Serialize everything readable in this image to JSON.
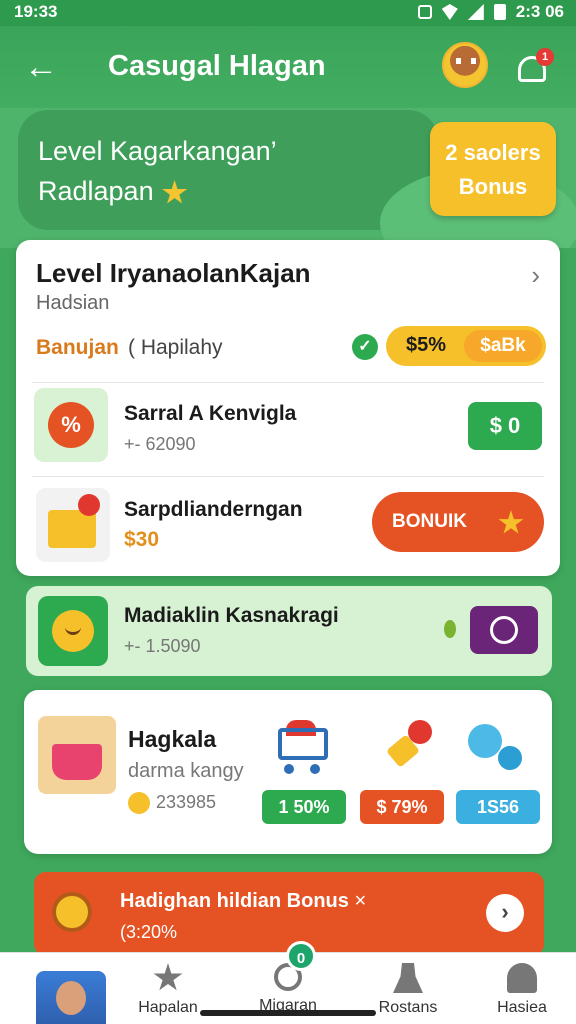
{
  "status_bar": {
    "time": "19:33",
    "right_time": "2:3 06"
  },
  "header": {
    "title": "Casugal Hlagan"
  },
  "notifications": {
    "badge": "1"
  },
  "banner": {
    "line1": "Level Kagarkangan’",
    "line2": "Radlapan",
    "badge_top": "2 saolers",
    "badge_bottom": "Bonus"
  },
  "level_card": {
    "title": "Level IryanaolanKajan",
    "subtitle": "Hadsian",
    "status_label": "Banujan",
    "status_note": "( Hapilahy",
    "pill_a": "$5%",
    "pill_b": "$aBk"
  },
  "rows": [
    {
      "title": "Sarral A Kenvigla",
      "sub": "+- 62090",
      "action": "$ 0"
    },
    {
      "title": "Sarpdlianderngan",
      "price": "$30",
      "action": "BONUIK"
    }
  ],
  "green_card": {
    "title": "Madiaklin Kasnakragi",
    "sub": "+- 1.5090"
  },
  "product_card": {
    "title": "Hagkala",
    "sub": "darma kangy",
    "count": "233985",
    "tags": [
      "1 50%",
      "$ 79%",
      "1S56"
    ]
  },
  "bonus_banner": {
    "title": "Hadighan hildian Bonus",
    "close": "×",
    "sub": "(3:20%"
  },
  "bottom_nav": {
    "badge": "0",
    "items": [
      "Hapalan",
      "Migaran",
      "Rostans",
      "Hasiea"
    ]
  }
}
